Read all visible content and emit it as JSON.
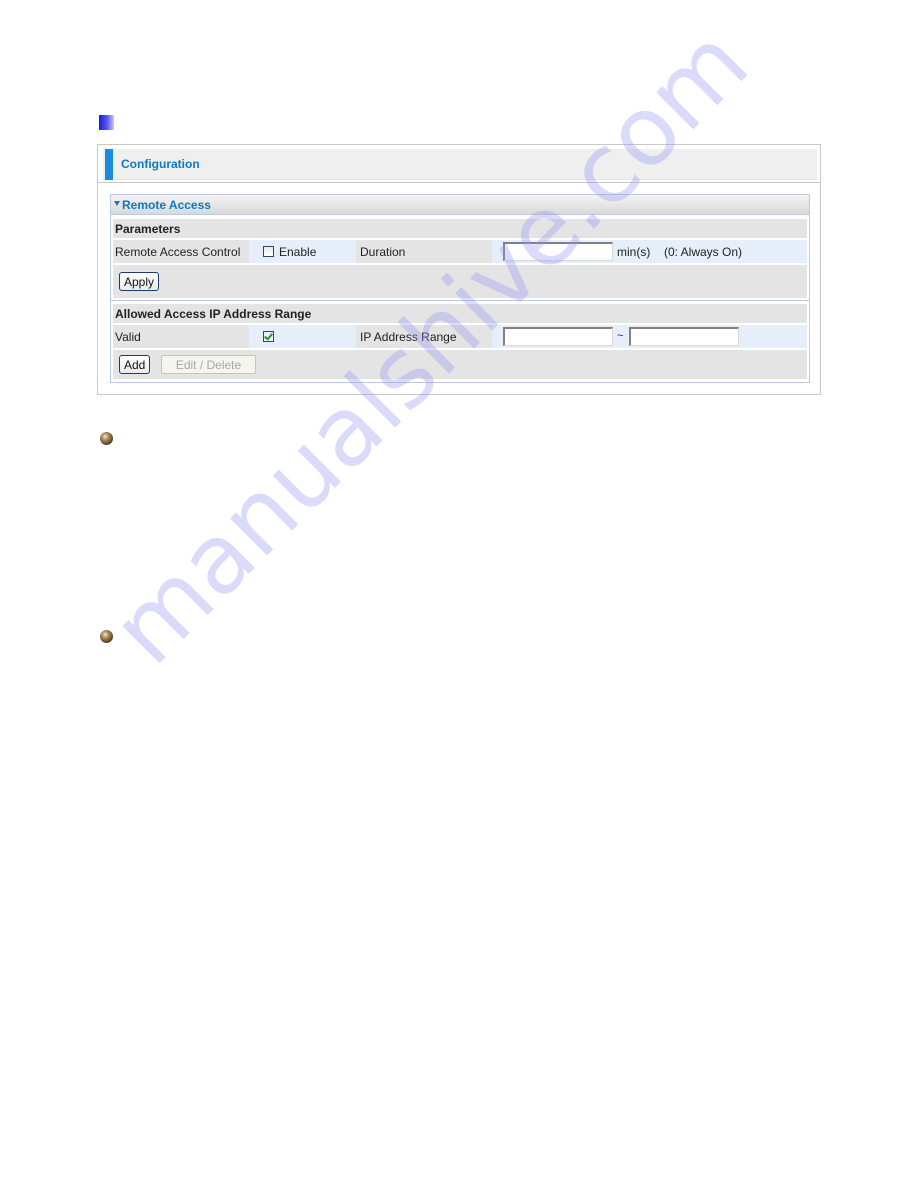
{
  "panel": {
    "title": "Configuration"
  },
  "remote_access": {
    "section_title": "Remote Access",
    "parameters": {
      "heading": "Parameters",
      "control_label": "Remote Access Control",
      "enable_label": "Enable",
      "enable_checked": false,
      "duration_label": "Duration",
      "duration_value": "",
      "duration_unit": "min(s)",
      "duration_hint": "(0: Always On)",
      "apply_label": "Apply"
    },
    "ip_range": {
      "heading": "Allowed Access IP Address Range",
      "valid_label": "Valid",
      "valid_checked": true,
      "range_label": "IP Address Range",
      "start_value": "",
      "separator": "~",
      "end_value": "",
      "add_label": "Add",
      "edit_delete_label": "Edit / Delete"
    }
  },
  "watermark": "manualshive.com",
  "colors": {
    "accent": "#0a7bc0",
    "header_bar": "#1b8be0",
    "check": "#1f9a2a"
  }
}
